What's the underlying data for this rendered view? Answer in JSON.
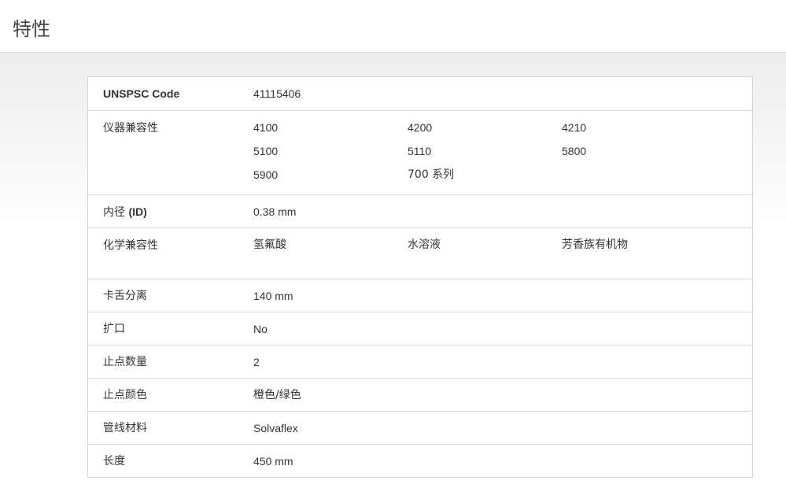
{
  "page": {
    "title": "特性"
  },
  "properties": {
    "unspsc": {
      "label": "UNSPSC Code",
      "value": "41115406"
    },
    "instrument_compat": {
      "label": "仪器兼容性",
      "values": [
        "4100",
        "4200",
        "4210",
        "5100",
        "5110",
        "5800",
        "5900",
        "700 系列"
      ]
    },
    "inner_diameter": {
      "label_prefix": "内径 ",
      "label_bold": "(ID)",
      "value": "0.38 mm"
    },
    "chemical_compat": {
      "label": "化学兼容性",
      "values": [
        "氢氟酸",
        "水溶液",
        "芳香族有机物"
      ]
    },
    "clamp_distance": {
      "label": "卡舌分离",
      "value": "140 mm"
    },
    "flared": {
      "label": "扩口",
      "value": "No"
    },
    "stop_count": {
      "label": "止点数量",
      "value": "2"
    },
    "stop_color": {
      "label": "止点颜色",
      "value": "橙色/绿色"
    },
    "tubing_material": {
      "label": "管线材料",
      "value": "Solvaflex"
    },
    "length": {
      "label": "长度",
      "value": "450 mm"
    }
  }
}
